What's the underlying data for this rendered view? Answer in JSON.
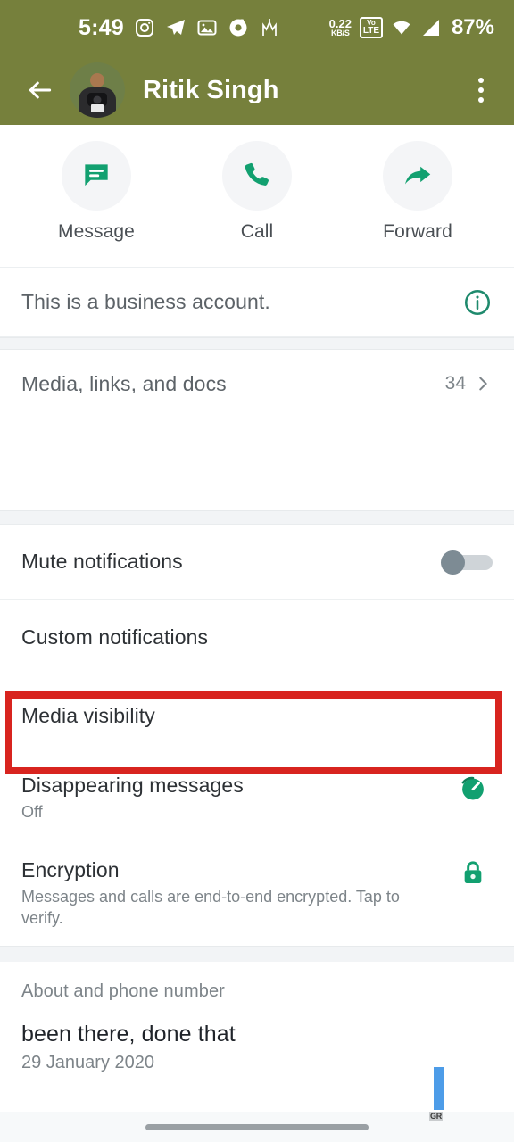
{
  "status_bar": {
    "clock": "5:49",
    "notification_icons": [
      "instagram-icon",
      "telegram-icon",
      "gallery-icon",
      "camera-record-icon",
      "app-icon"
    ],
    "data_rate_value": "0.22",
    "data_rate_unit": "KB/S",
    "network_badge_top": "Vo",
    "network_badge_bottom": "LTE",
    "wifi_icon": "wifi-icon",
    "signal_icon": "cellular-signal-icon",
    "battery": "87%"
  },
  "app_bar": {
    "back_icon": "back-arrow-icon",
    "avatar": "contact-avatar",
    "contact_name": "Ritik Singh",
    "overflow_icon": "overflow-menu-icon"
  },
  "actions": [
    {
      "label": "Message",
      "icon": "message-icon"
    },
    {
      "label": "Call",
      "icon": "phone-icon"
    },
    {
      "label": "Forward",
      "icon": "forward-arrow-icon"
    }
  ],
  "business_row": {
    "label": "This is a business account.",
    "icon": "info-circle-icon"
  },
  "media_row": {
    "label": "Media, links, and docs",
    "count": "34",
    "chevron": "chevron-right-icon"
  },
  "settings": {
    "mute": {
      "label": "Mute notifications",
      "toggle_state": "off"
    },
    "custom": {
      "label": "Custom notifications"
    },
    "media_visibility": {
      "label": "Media visibility"
    },
    "disappearing": {
      "label": "Disappearing messages",
      "value": "Off",
      "icon": "timer-icon"
    },
    "encryption": {
      "label": "Encryption",
      "description": "Messages and calls are end-to-end encrypted. Tap to verify.",
      "icon": "lock-icon"
    }
  },
  "about": {
    "header": "About and phone number",
    "status_text": "been there, done that",
    "date": "29 January 2020"
  },
  "overlay": {
    "watermark": "GR"
  },
  "colors": {
    "header_olive": "#76803c",
    "whatsapp_green": "#12a070",
    "annotation_red": "#d8241f",
    "accent_blue": "#4d9ce8"
  }
}
